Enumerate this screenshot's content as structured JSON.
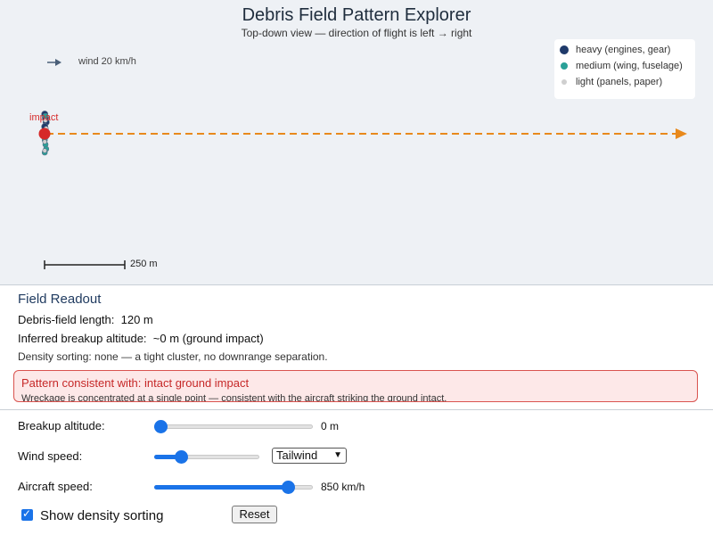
{
  "header": {
    "title": "Debris Field Pattern Explorer",
    "subtitle": "Top-down view — direction of flight is left → right"
  },
  "legend": {
    "items": [
      {
        "label": "heavy (engines, gear)",
        "color": "#1f3a6a"
      },
      {
        "label": "medium (wing, fuselage)",
        "color": "#2aa198"
      },
      {
        "label": "light (panels, paper)",
        "color": "#cfcfcf"
      }
    ]
  },
  "plot": {
    "wind_label": "wind 20 km/h",
    "impact_label": "impact",
    "scale_label": "250 m",
    "flight_arrow_color": "#e8891c",
    "impact_color": "#d62828",
    "debris_counts": {
      "heavy": 6,
      "medium": 5,
      "light": 5
    }
  },
  "readout": {
    "title": "Field Readout",
    "length_label": "Debris-field length:",
    "length_value": "120 m",
    "altitude_label": "Inferred breakup altitude:",
    "altitude_value": "~0 m (ground impact)",
    "density_note": "Density sorting: none — a tight cluster, no downrange separation.",
    "verdict_title": "Pattern consistent with: intact ground impact",
    "verdict_desc": "Wreckage is concentrated at a single point — consistent with the aircraft striking the ground intact."
  },
  "controls": {
    "breakup": {
      "label": "Breakup altitude:",
      "value_text": "0 m",
      "fraction": 0.0
    },
    "wind": {
      "label": "Wind speed:",
      "fraction": 0.25,
      "direction": "Tailwind"
    },
    "speed": {
      "label": "Aircraft speed:",
      "value_text": "850 km/h",
      "fraction": 0.84
    },
    "density_checkbox": {
      "label": "Show density sorting",
      "checked": true
    },
    "reset_label": "Reset"
  }
}
